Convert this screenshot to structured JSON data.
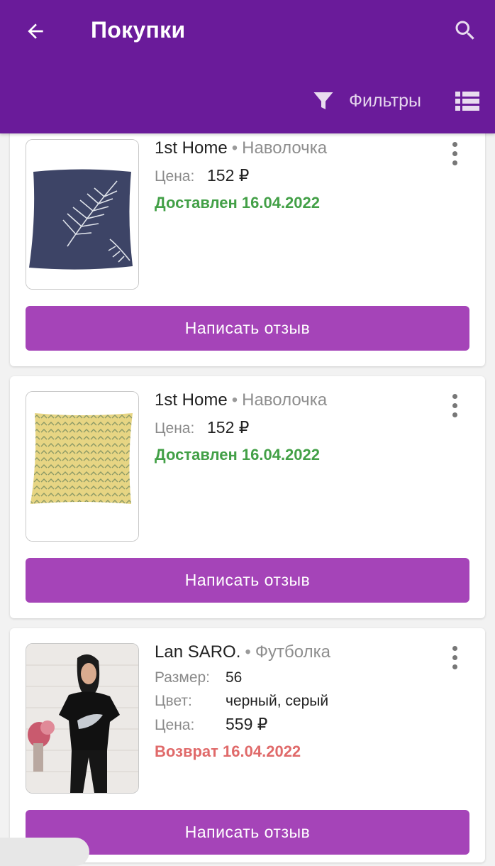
{
  "header": {
    "title": "Покупки",
    "filters_label": "Фильтры",
    "back_icon": "arrow-back-icon",
    "search_icon": "search-icon",
    "filter_icon": "funnel-icon",
    "view_icon": "list-view-icon",
    "bar_color": "#6a1b9a"
  },
  "labels": {
    "price": "Цена:",
    "size": "Размер:",
    "color": "Цвет:",
    "review_button": "Написать отзыв"
  },
  "orders": [
    {
      "brand": "1st Home",
      "category": "Наволочка",
      "price": "152 ₽",
      "status": "Доставлен 16.04.2022",
      "image": "navy-pillow-with-fern-print"
    },
    {
      "brand": "1st Home",
      "category": "Наволочка",
      "price": "152 ₽",
      "status": "Доставлен 16.04.2022",
      "image": "yellow-patterned-pillow"
    },
    {
      "brand": "Lan SARO.",
      "category": "Футболка",
      "size": "56",
      "color": "черный, серый",
      "price": "559 ₽",
      "status": "Возврат 16.04.2022",
      "image": "woman-in-black-t-shirt"
    }
  ],
  "colors": {
    "delivered": "#43a047",
    "returned": "#e06a6a",
    "button": "#a544b8"
  }
}
